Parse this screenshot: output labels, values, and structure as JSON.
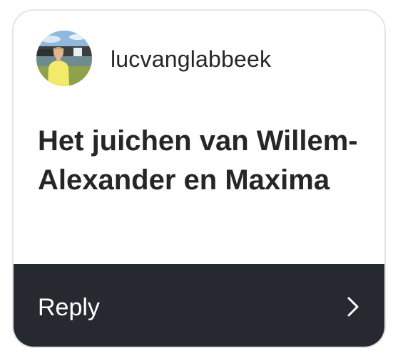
{
  "card": {
    "username": "lucvanglabbeek",
    "question": "Het juichen van Willem-Alexander en Maxima",
    "reply_label": "Reply",
    "avatar_icon": "profile-photo",
    "reply_icon": "chevron-right-icon"
  },
  "colors": {
    "card_background": "#ffffff",
    "card_border": "#e5e5e7",
    "text": "#262626",
    "reply_bar": "#262a30",
    "reply_text": "#ffffff"
  }
}
